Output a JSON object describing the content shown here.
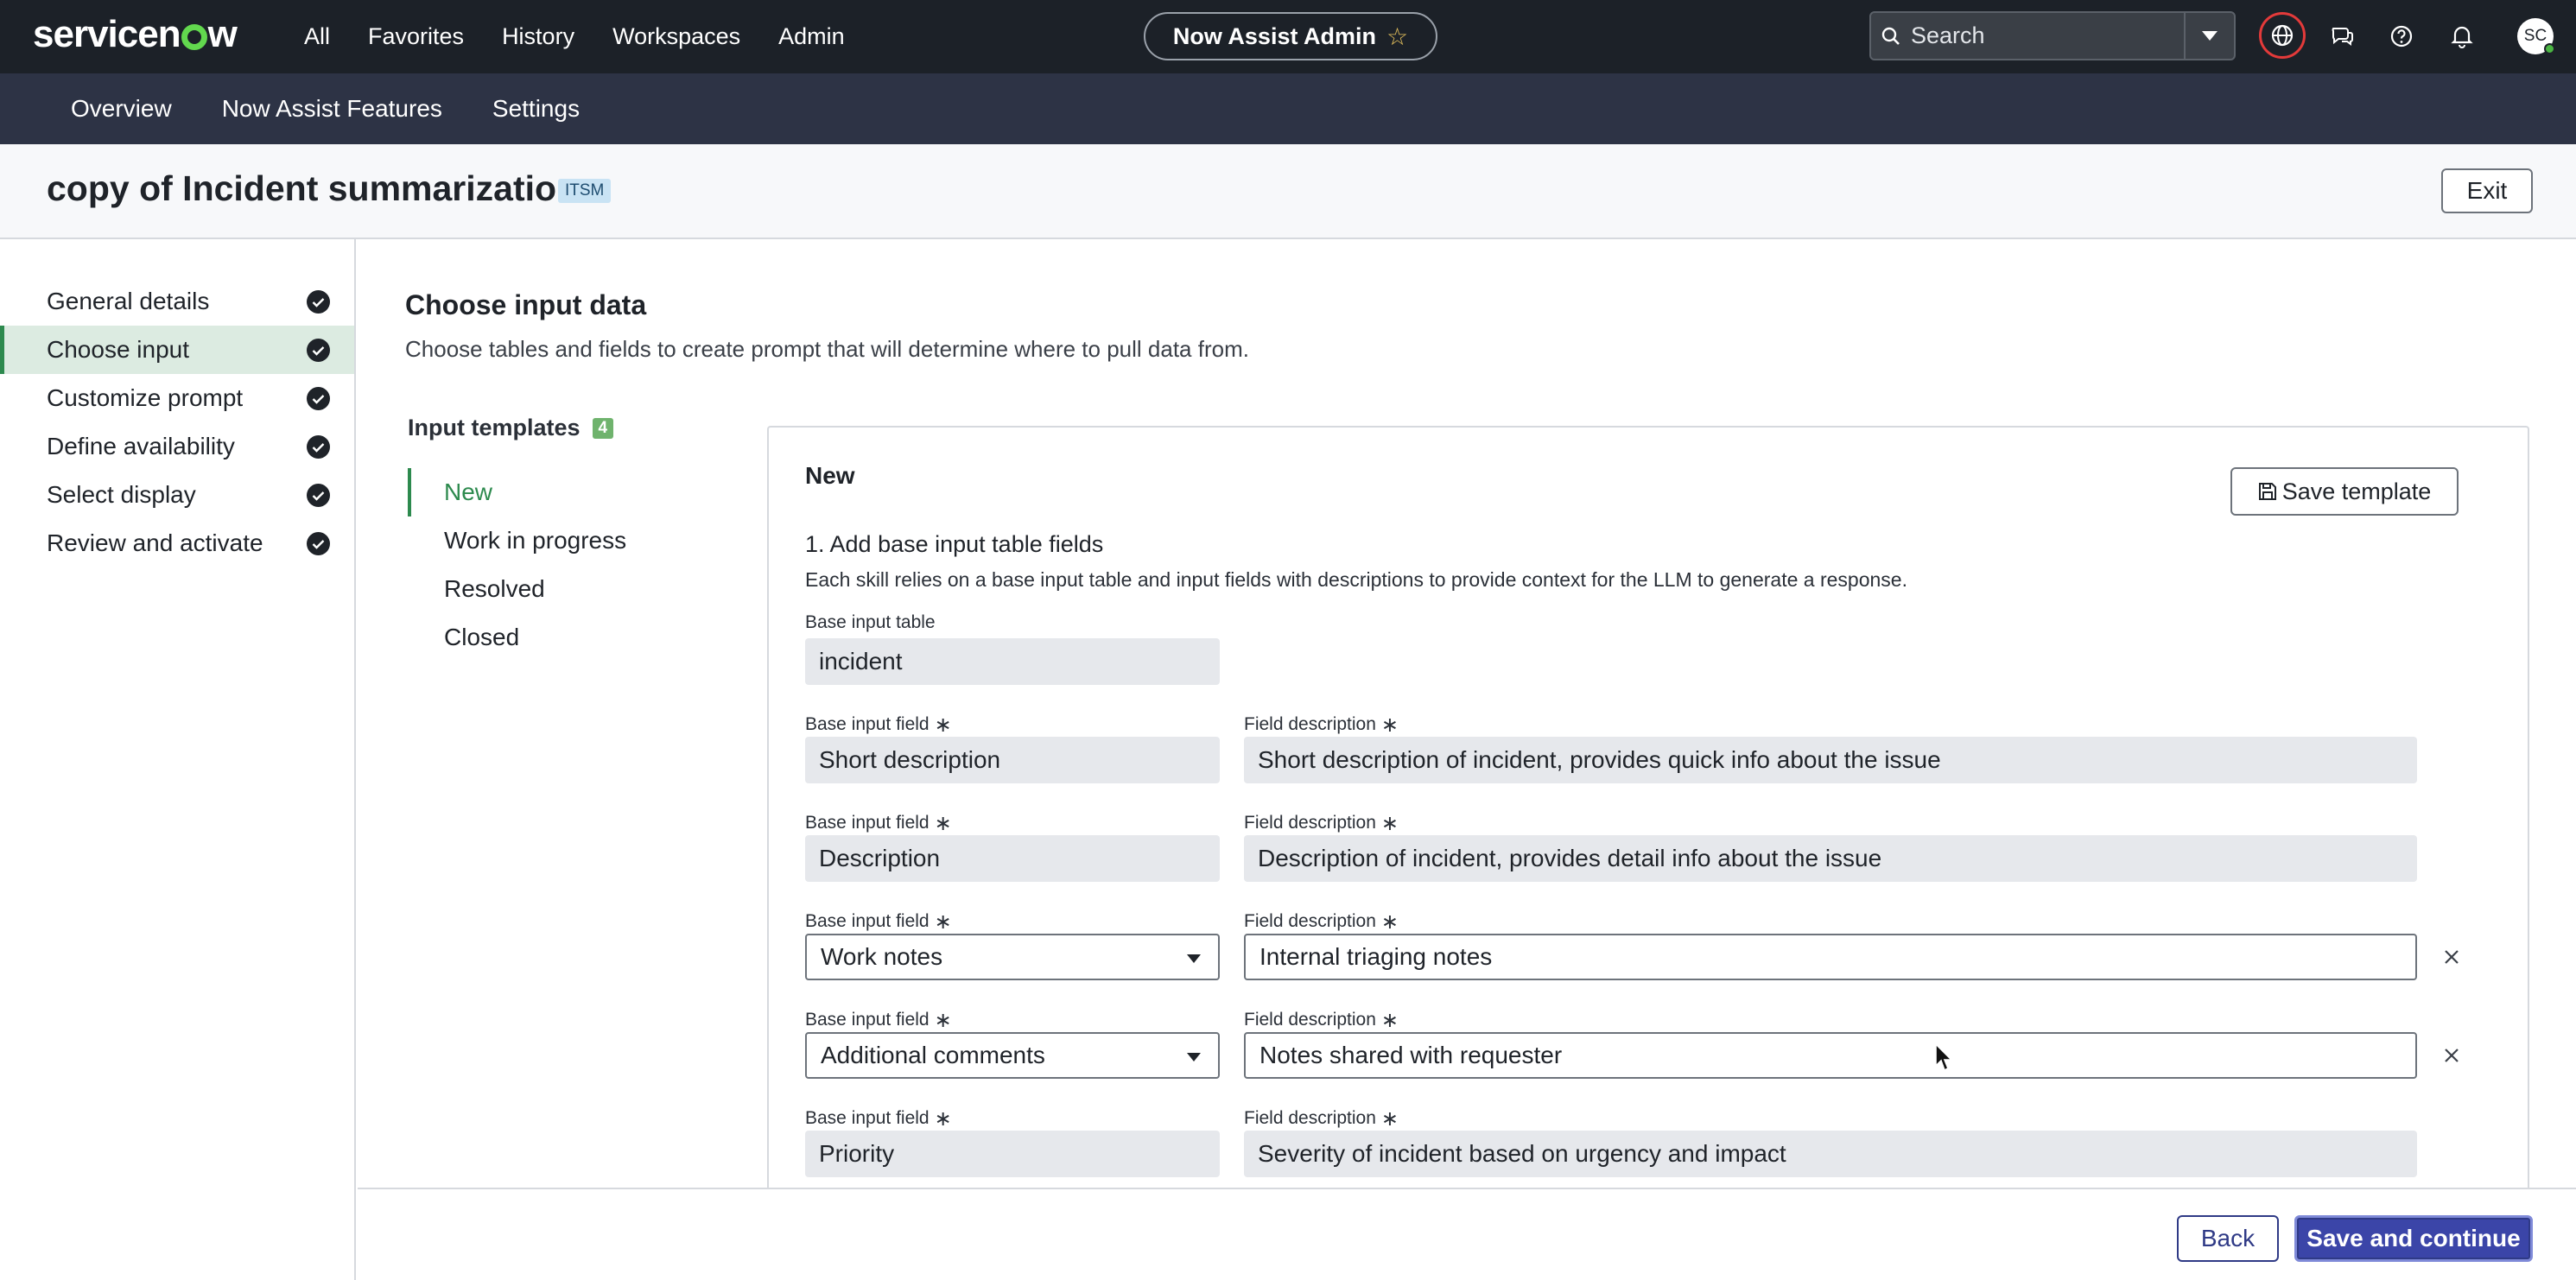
{
  "brand": {
    "logo_text_left": "servicen",
    "logo_text_right": "w"
  },
  "topnav": {
    "menu": [
      "All",
      "Favorites",
      "History",
      "Workspaces",
      "Admin"
    ],
    "context_title": "Now Assist Admin",
    "context_icon": "star-icon",
    "search_placeholder": "Search",
    "icons": [
      "globe-icon",
      "chat-icon",
      "help-icon",
      "bell-icon"
    ],
    "avatar_initials": "SC"
  },
  "subnav": {
    "items": [
      "Overview",
      "Now Assist Features",
      "Settings"
    ]
  },
  "header": {
    "title": "copy of Incident summarization",
    "badge": "ITSM",
    "exit_label": "Exit"
  },
  "steps": [
    {
      "label": "General details",
      "done": true
    },
    {
      "label": "Choose input",
      "done": true,
      "active": true
    },
    {
      "label": "Customize prompt",
      "done": true
    },
    {
      "label": "Define availability",
      "done": true
    },
    {
      "label": "Select display",
      "done": true
    },
    {
      "label": "Review and activate",
      "done": true
    }
  ],
  "main": {
    "title": "Choose input data",
    "subtitle": "Choose tables and fields to create prompt that will determine where to pull data from.",
    "templates_label": "Input templates",
    "templates_count": "4",
    "templates": [
      "New",
      "Work in progress",
      "Resolved",
      "Closed"
    ],
    "active_template": "New"
  },
  "card": {
    "title": "New",
    "save_template_label": "Save template",
    "step_heading": "1. Add base input table fields",
    "step_description": "Each skill relies on a base input table and input fields with descriptions to provide context for the LLM to generate a response.",
    "base_table_label": "Base input table",
    "base_table_value": "incident",
    "field_label": "Base input field",
    "desc_label": "Field description",
    "required_mark": "∗",
    "rows": [
      {
        "field": "Short description",
        "description": "Short description of incident, provides quick info about the issue",
        "editable": false
      },
      {
        "field": "Description",
        "description": "Description of incident, provides detail info about the issue",
        "editable": false
      },
      {
        "field": "Work notes",
        "description": "Internal triaging notes",
        "editable": true
      },
      {
        "field": "Additional comments",
        "description": "Notes shared with requester",
        "editable": true
      },
      {
        "field": "Priority",
        "description": "Severity of incident based on urgency and impact",
        "editable": false
      }
    ]
  },
  "footer": {
    "back_label": "Back",
    "save_continue_label": "Save and continue"
  },
  "colors": {
    "accent_green": "#2d8a4e",
    "primary_button": "#3b45a8",
    "navbar": "#1c2128",
    "subnav": "#2d3345"
  }
}
